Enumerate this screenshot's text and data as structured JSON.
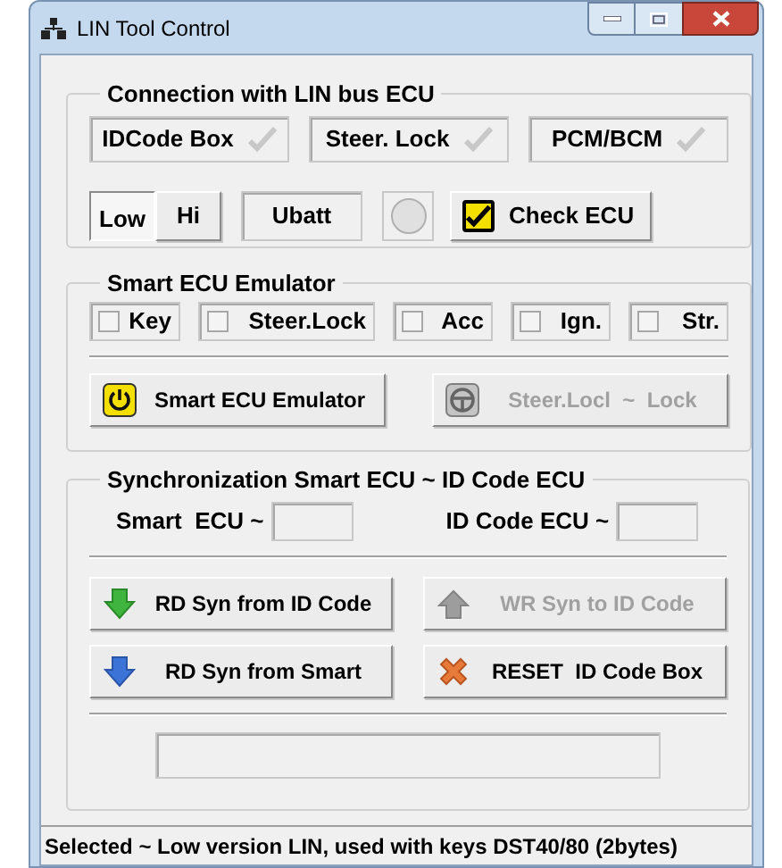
{
  "window": {
    "title": "LIN Tool Control"
  },
  "connection": {
    "title": "Connection with LIN bus ECU",
    "modules": [
      {
        "label": "IDCode Box",
        "connected": false
      },
      {
        "label": "Steer. Lock",
        "connected": false
      },
      {
        "label": "PCM/BCM",
        "connected": false
      }
    ],
    "versions": [
      {
        "label": "Low",
        "selected": true
      },
      {
        "label": "Hi",
        "selected": false
      }
    ],
    "ubatt": "Ubatt",
    "led_on": false,
    "check_button": {
      "label": "Check ECU",
      "checked": true
    }
  },
  "emulator": {
    "title": "Smart ECU Emulator",
    "checkboxes": [
      {
        "label": "Key",
        "checked": false
      },
      {
        "label": "Steer.Lock",
        "checked": false
      },
      {
        "label": "Acc",
        "checked": false
      },
      {
        "label": "Ign.",
        "checked": false
      },
      {
        "label": "Str.",
        "checked": false
      }
    ],
    "buttons": [
      {
        "label": "Smart ECU Emulator",
        "kind": "power",
        "disabled": false
      },
      {
        "label": "Steer.Locl  ~  Lock",
        "kind": "wheel",
        "disabled": true
      }
    ]
  },
  "sync": {
    "title": "Synchronization Smart ECU ~ ID Code ECU",
    "fields": [
      {
        "label": "Smart  ECU ~"
      },
      {
        "label": "ID Code ECU ~"
      }
    ],
    "buttons": [
      {
        "label": "RD Syn from ID Code",
        "kind": "down-green",
        "disabled": false
      },
      {
        "label": "WR Syn to ID Code",
        "kind": "up",
        "disabled": true
      },
      {
        "label": "RD Syn from Smart",
        "kind": "down-blue",
        "disabled": false
      },
      {
        "label": "RESET  ID Code Box",
        "kind": "cross",
        "disabled": false
      }
    ]
  },
  "status_bar": {
    "text": "Selected ~ Low version LIN, used with keys DST40/80 (2bytes)"
  }
}
